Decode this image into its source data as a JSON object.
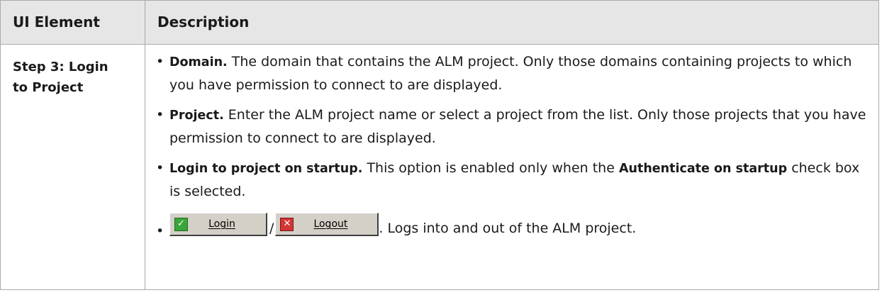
{
  "table": {
    "headers": {
      "element": "UI Element",
      "description": "Description"
    },
    "row": {
      "element_line1": "Step 3: Login",
      "element_line2": "to Project",
      "items": [
        {
          "term": "Domain.",
          "text": " The domain that contains the ALM project. Only those domains containing projects to which you have permission to connect to are displayed."
        },
        {
          "term": "Project.",
          "text": " Enter the ALM project name or select a project from the list. Only those projects that you have permission to connect to are displayed."
        }
      ],
      "startup_item": {
        "term": "Login to project on startup.",
        "text_before": " This option is enabled only when the ",
        "bold_ref": "Authenticate on startup",
        "text_after": " check box is selected."
      },
      "buttons_item": {
        "login_label": "Login",
        "separator": "/",
        "logout_label": "Logout",
        "text": ". Logs into and out of the ALM project."
      }
    }
  },
  "icons": {
    "login": "check-icon",
    "logout": "x-icon"
  },
  "colors": {
    "header_bg": "#e6e6e6",
    "border": "#a9a9a9",
    "button_face": "#d4d0c8",
    "check_green": "#3aa53a",
    "x_red": "#d33434"
  }
}
